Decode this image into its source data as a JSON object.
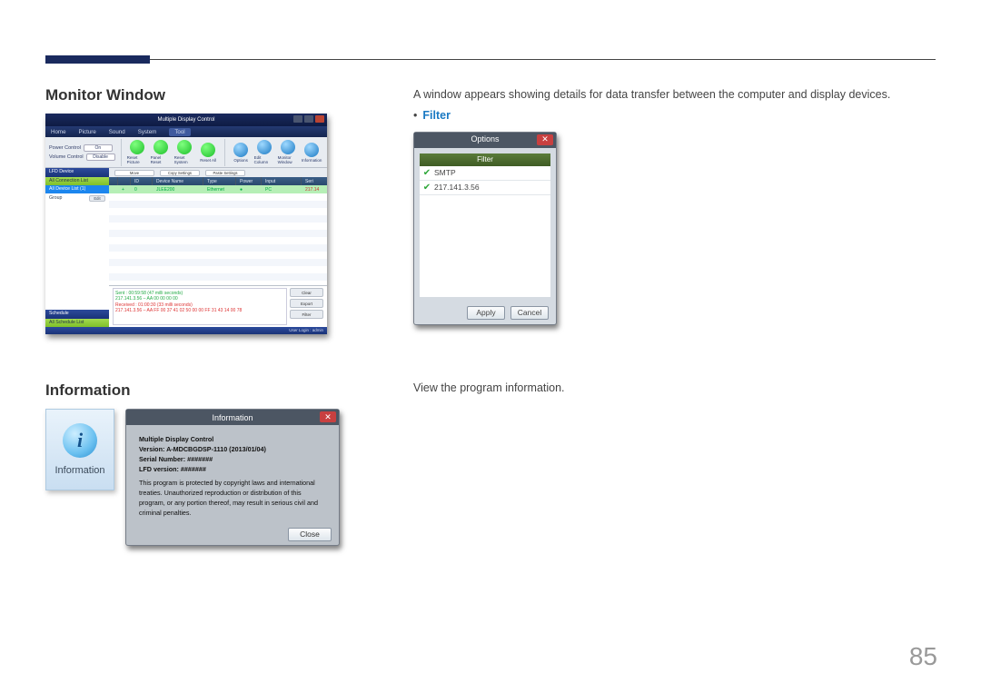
{
  "headings": {
    "monitor_window": "Monitor Window",
    "information": "Information"
  },
  "text": {
    "monitor_desc": "A window appears showing details for data transfer between the computer and display devices.",
    "filter_label": "Filter",
    "information_desc": "View the program information."
  },
  "mdc": {
    "title": "Multiple Display Control",
    "tabs": [
      "Home",
      "Picture",
      "Sound",
      "System",
      "Tool"
    ],
    "toolbar": {
      "power_control_label": "Power Control",
      "power_control_value": "On",
      "volume_control_label": "Volume Control",
      "volume_control_value": "Disable",
      "icons": [
        "Reset Picture",
        "Panel Reset",
        "Reset System",
        "Reset All",
        "Options",
        "Edit Column",
        "Monitor Window",
        "Information"
      ]
    },
    "sidebar": {
      "lfd_device": "LFD Device",
      "all_connection_list": "All Connection List",
      "all_device_list": "All Device List (1)",
      "group": "Group",
      "edit": "Edit",
      "schedule": "Schedule",
      "all_schedule_list": "All Schedule List"
    },
    "gridbar_btns": [
      "Move",
      "Copy Settings",
      "Paste Settings"
    ],
    "columns": [
      "",
      "",
      "ID",
      "Device Name",
      "Type",
      "Power",
      "Input",
      "Seri"
    ],
    "row": [
      "",
      "+",
      "0",
      "JLEE200",
      "Ethernet",
      "●",
      "PC",
      "217.14"
    ],
    "monitor_window_label": "Monitor Window",
    "log_sent": "Sent : 00:59:58 (47 milli seconds)",
    "log_ip": "217.141.3.56 – AA 00 00 00 00",
    "log_recv": "Received : 01:00:30 (33 milli seconds)",
    "log_hex": "217.141.3.56 – AA FF 00 37 41 02 50 00 00 FF 31 43 14 00 78",
    "mon_buttons": [
      "Clear",
      "Export",
      "Filter"
    ],
    "statusbar": "User Login : admin"
  },
  "filter_dialog": {
    "title": "Options",
    "column_header": "Filter",
    "rows": [
      "SMTP",
      "217.141.3.56"
    ],
    "apply": "Apply",
    "cancel": "Cancel"
  },
  "info_tile_label": "Information",
  "info_dialog": {
    "title": "Information",
    "product": "Multiple Display Control",
    "version_label": "Version: A-MDCBGDSP-1110 (2013/01/04)",
    "serial_label": "Serial Number: #######",
    "lfd_label": "LFD version: #######",
    "legal": "This program is protected by copyright laws and international treaties. Unauthorized reproduction or distribution of this program, or any portion thereof, may result in serious civil and criminal penalties.",
    "close": "Close"
  },
  "page_number": "85"
}
